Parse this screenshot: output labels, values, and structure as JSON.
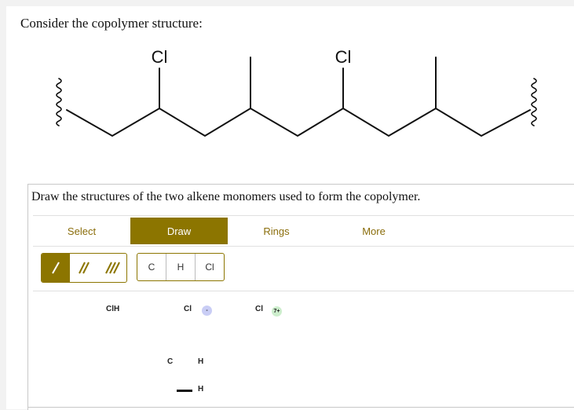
{
  "question": "Consider the copolymer structure:",
  "structure": {
    "substituent_left": "Cl",
    "substituent_right": "Cl"
  },
  "instruction": "Draw the structures of the two alkene monomers used to form the copolymer.",
  "tabs": [
    {
      "label": "Select",
      "active": false
    },
    {
      "label": "Draw",
      "active": true
    },
    {
      "label": "Rings",
      "active": false
    },
    {
      "label": "More",
      "active": false
    }
  ],
  "bond_tools": [
    "single-bond",
    "double-bond",
    "triple-bond"
  ],
  "atom_tools": [
    "C",
    "H",
    "Cl"
  ],
  "canvas": {
    "label_clh": "ClH",
    "label_cl_1": "Cl",
    "badge_minus": "-",
    "label_cl_2": "Cl",
    "badge_charge": "7+",
    "label_c": "C",
    "label_h_1": "H",
    "label_h_2": "H"
  },
  "colors": {
    "accent": "#8c7500",
    "minus_badge": "#c9cdf5",
    "charge_badge": "#cdeecd"
  }
}
